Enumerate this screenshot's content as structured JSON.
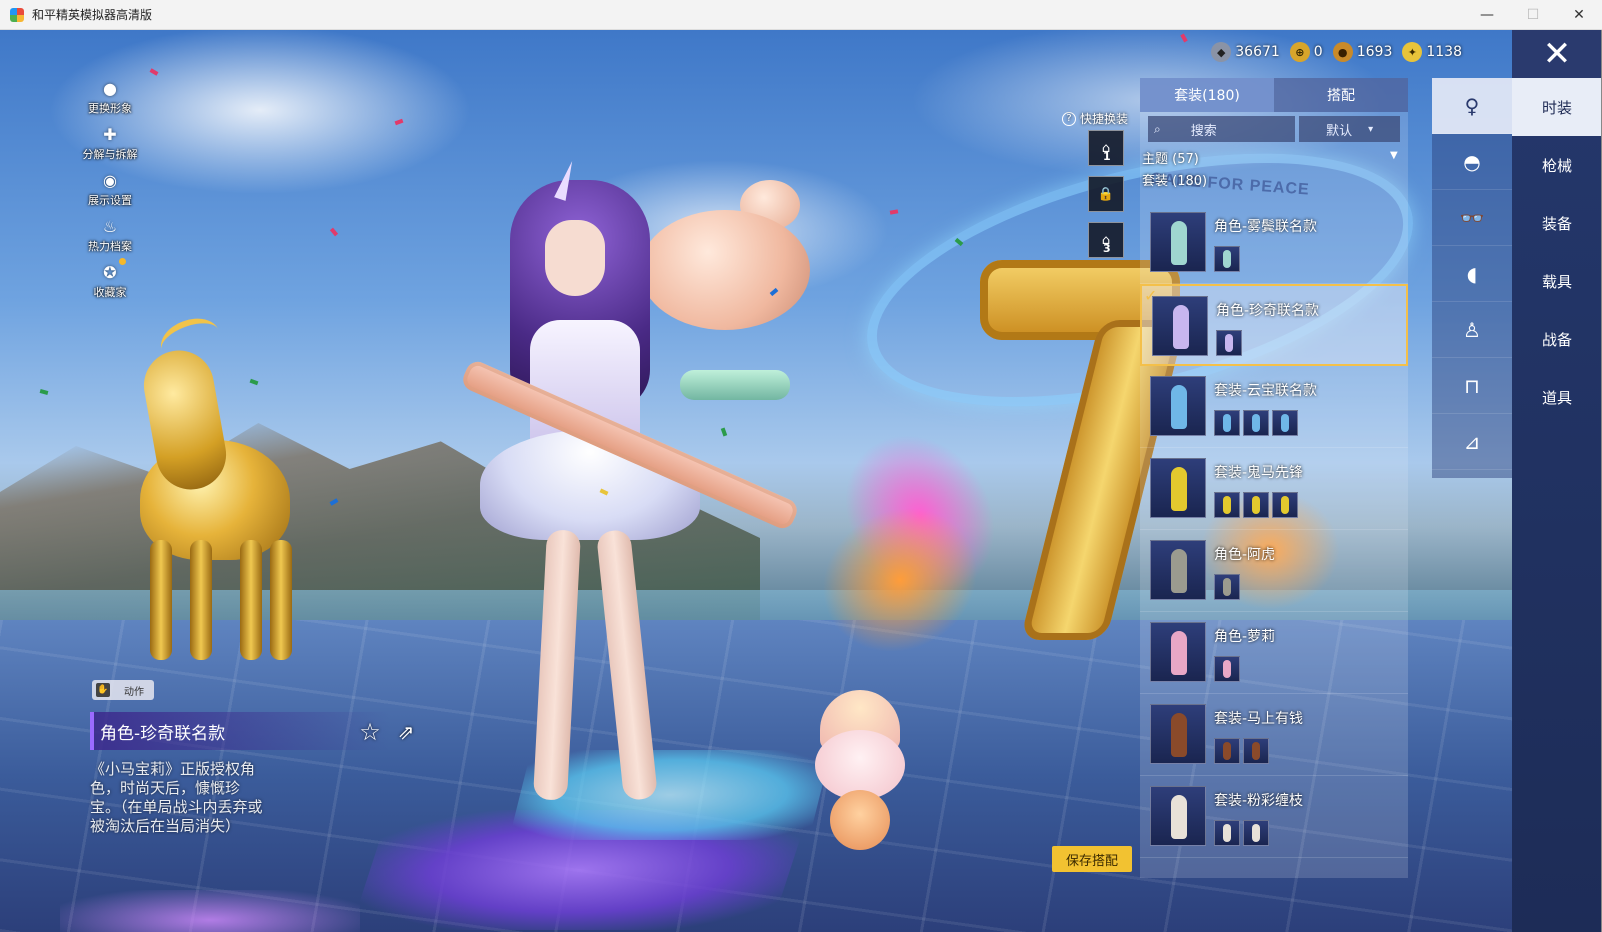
{
  "window": {
    "title": "和平精英模拟器高清版",
    "minimize": "—",
    "maximize": "☐",
    "close": "✕"
  },
  "left_menu": [
    {
      "label": "更换形象",
      "icon": "person-icon"
    },
    {
      "label": "分解与拆解",
      "icon": "puzzle-icon"
    },
    {
      "label": "展示设置",
      "icon": "eye-icon"
    },
    {
      "label": "热力档案",
      "icon": "flame-icon"
    },
    {
      "label": "收藏家",
      "icon": "collector-badge-icon"
    }
  ],
  "item_info": {
    "action_label": "动作",
    "title": "角色-珍奇联名款",
    "description": "《小马宝莉》正版授权角色，时尚天后，慷慨珍宝。（在单局战斗内丢弃或被淘汰后在当局消失）"
  },
  "currency": [
    {
      "value": "36671",
      "color": "#8a93a6",
      "symbol": "◆"
    },
    {
      "value": "0",
      "color": "#d8a52a",
      "symbol": "⊕"
    },
    {
      "value": "1693",
      "color": "#c98a2a",
      "symbol": "●"
    },
    {
      "value": "1138",
      "color": "#e8c43a",
      "symbol": "✦"
    }
  ],
  "close_button": "✕",
  "categories": [
    {
      "label": "时装",
      "active": true
    },
    {
      "label": "枪械",
      "active": false
    },
    {
      "label": "装备",
      "active": false
    },
    {
      "label": "载具",
      "active": false
    },
    {
      "label": "战备",
      "active": false
    },
    {
      "label": "道具",
      "active": false
    }
  ],
  "subcategories": [
    {
      "icon": "outfit-figure-icon",
      "glyph": "♀",
      "active": true
    },
    {
      "icon": "cap-icon",
      "glyph": "◓",
      "active": false
    },
    {
      "icon": "glasses-icon",
      "glyph": "👓",
      "active": false
    },
    {
      "icon": "mask-icon",
      "glyph": "◖",
      "active": false
    },
    {
      "icon": "top-icon",
      "glyph": "♙",
      "active": false
    },
    {
      "icon": "pants-icon",
      "glyph": "⊓",
      "active": false
    },
    {
      "icon": "shoes-icon",
      "glyph": "⊿",
      "active": false
    }
  ],
  "panel": {
    "tabs": [
      {
        "label": "套装(180)",
        "active": true
      },
      {
        "label": "搭配",
        "active": false
      }
    ],
    "search_placeholder": "搜索",
    "sort_label": "默认",
    "filter_main": "主题 (57)",
    "filter_sub": "套装 (180)"
  },
  "quick_swap": {
    "label": "快捷换装",
    "slots": [
      "1",
      "2",
      "3"
    ]
  },
  "outfits": [
    {
      "name": "角色-雾鬓联名款",
      "subs": 1,
      "selected": false,
      "color": "#9fd6d0"
    },
    {
      "name": "角色-珍奇联名款",
      "subs": 1,
      "selected": true,
      "color": "#c8b6ef"
    },
    {
      "name": "套装-云宝联名款",
      "subs": 3,
      "selected": false,
      "color": "#6fb7e8"
    },
    {
      "name": "套装-鬼马先锋",
      "subs": 3,
      "selected": false,
      "color": "#e3c92e"
    },
    {
      "name": "角色-阿虎",
      "subs": 1,
      "selected": false,
      "color": "#9b9b8f"
    },
    {
      "name": "角色-萝莉",
      "subs": 1,
      "selected": false,
      "color": "#e8a7c6"
    },
    {
      "name": "套装-马上有钱",
      "subs": 2,
      "selected": false,
      "color": "#8a4a2a"
    },
    {
      "name": "套装-粉彩缠枝",
      "subs": 2,
      "selected": false,
      "color": "#e8e1d8"
    }
  ],
  "save_button": "保存搭配",
  "banner_text": "GAME FOR PEACE"
}
